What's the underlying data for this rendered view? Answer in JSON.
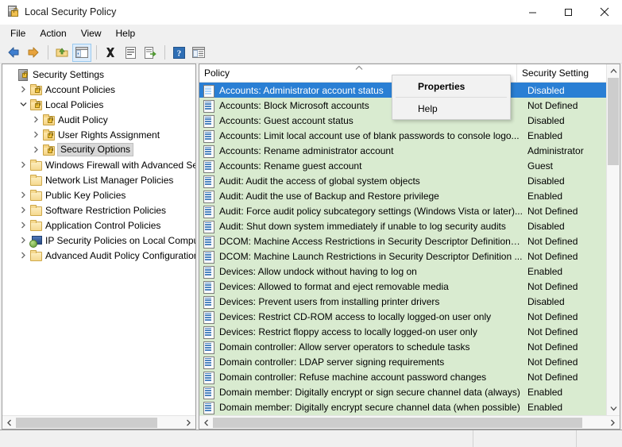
{
  "window": {
    "title": "Local Security Policy",
    "icon": "security-policy-icon",
    "controls": {
      "minimize": "—",
      "maximize": "☐",
      "close": "✕"
    }
  },
  "menubar": {
    "items": [
      "File",
      "Action",
      "View",
      "Help"
    ]
  },
  "toolbar": {
    "buttons": [
      {
        "name": "back-icon",
        "glyph": "back"
      },
      {
        "name": "forward-icon",
        "glyph": "forward"
      },
      {
        "name": "up-folder-icon",
        "glyph": "upfolder"
      },
      {
        "name": "show-tree-icon",
        "glyph": "showtree",
        "active": true
      },
      {
        "name": "delete-icon",
        "glyph": "delete"
      },
      {
        "name": "properties-icon",
        "glyph": "properties"
      },
      {
        "name": "export-list-icon",
        "glyph": "export"
      },
      {
        "name": "help-icon",
        "glyph": "help"
      },
      {
        "name": "list-view-icon",
        "glyph": "listview"
      }
    ]
  },
  "tree": {
    "items": [
      {
        "label": "Security Settings",
        "indent": 0,
        "expander": "none",
        "icon": "root",
        "selected": false
      },
      {
        "label": "Account Policies",
        "indent": 1,
        "expander": "collapsed",
        "icon": "lockfolder",
        "selected": false
      },
      {
        "label": "Local Policies",
        "indent": 1,
        "expander": "expanded",
        "icon": "lockfolder",
        "selected": false
      },
      {
        "label": "Audit Policy",
        "indent": 2,
        "expander": "collapsed",
        "icon": "lockfolder",
        "selected": false
      },
      {
        "label": "User Rights Assignment",
        "indent": 2,
        "expander": "collapsed",
        "icon": "lockfolder",
        "selected": false
      },
      {
        "label": "Security Options",
        "indent": 2,
        "expander": "collapsed",
        "icon": "lockfolder",
        "selected": true
      },
      {
        "label": "Windows Firewall with Advanced Sec",
        "indent": 1,
        "expander": "collapsed",
        "icon": "plainfolder",
        "selected": false
      },
      {
        "label": "Network List Manager Policies",
        "indent": 1,
        "expander": "none",
        "icon": "plainfolder",
        "selected": false
      },
      {
        "label": "Public Key Policies",
        "indent": 1,
        "expander": "collapsed",
        "icon": "plainfolder",
        "selected": false
      },
      {
        "label": "Software Restriction Policies",
        "indent": 1,
        "expander": "collapsed",
        "icon": "plainfolder",
        "selected": false
      },
      {
        "label": "Application Control Policies",
        "indent": 1,
        "expander": "collapsed",
        "icon": "plainfolder",
        "selected": false
      },
      {
        "label": "IP Security Policies on Local Compute",
        "indent": 1,
        "expander": "collapsed",
        "icon": "ipsec",
        "selected": false
      },
      {
        "label": "Advanced Audit Policy Configuration",
        "indent": 1,
        "expander": "collapsed",
        "icon": "plainfolder",
        "selected": false
      }
    ]
  },
  "list": {
    "columns": [
      {
        "label": "Policy",
        "sort": "ascending"
      },
      {
        "label": "Security Setting",
        "sort": "none"
      }
    ],
    "rows": [
      {
        "policy": "Accounts: Administrator account status",
        "setting": "Disabled",
        "selected": true
      },
      {
        "policy": "Accounts: Block Microsoft accounts",
        "setting": "Not Defined",
        "selected": false
      },
      {
        "policy": "Accounts: Guest account status",
        "setting": "Disabled",
        "selected": false
      },
      {
        "policy": "Accounts: Limit local account use of blank passwords to console logo...",
        "setting": "Enabled",
        "selected": false
      },
      {
        "policy": "Accounts: Rename administrator account",
        "setting": "Administrator",
        "selected": false
      },
      {
        "policy": "Accounts: Rename guest account",
        "setting": "Guest",
        "selected": false
      },
      {
        "policy": "Audit: Audit the access of global system objects",
        "setting": "Disabled",
        "selected": false
      },
      {
        "policy": "Audit: Audit the use of Backup and Restore privilege",
        "setting": "Enabled",
        "selected": false
      },
      {
        "policy": "Audit: Force audit policy subcategory settings (Windows Vista or later)...",
        "setting": "Not Defined",
        "selected": false
      },
      {
        "policy": "Audit: Shut down system immediately if unable to log security audits",
        "setting": "Disabled",
        "selected": false
      },
      {
        "policy": "DCOM: Machine Access Restrictions in Security Descriptor Definition L...",
        "setting": "Not Defined",
        "selected": false
      },
      {
        "policy": "DCOM: Machine Launch Restrictions in Security Descriptor Definition ...",
        "setting": "Not Defined",
        "selected": false
      },
      {
        "policy": "Devices: Allow undock without having to log on",
        "setting": "Enabled",
        "selected": false
      },
      {
        "policy": "Devices: Allowed to format and eject removable media",
        "setting": "Not Defined",
        "selected": false
      },
      {
        "policy": "Devices: Prevent users from installing printer drivers",
        "setting": "Disabled",
        "selected": false
      },
      {
        "policy": "Devices: Restrict CD-ROM access to locally logged-on user only",
        "setting": "Not Defined",
        "selected": false
      },
      {
        "policy": "Devices: Restrict floppy access to locally logged-on user only",
        "setting": "Not Defined",
        "selected": false
      },
      {
        "policy": "Domain controller: Allow server operators to schedule tasks",
        "setting": "Not Defined",
        "selected": false
      },
      {
        "policy": "Domain controller: LDAP server signing requirements",
        "setting": "Not Defined",
        "selected": false
      },
      {
        "policy": "Domain controller: Refuse machine account password changes",
        "setting": "Not Defined",
        "selected": false
      },
      {
        "policy": "Domain member: Digitally encrypt or sign secure channel data (always)",
        "setting": "Enabled",
        "selected": false
      },
      {
        "policy": "Domain member: Digitally encrypt secure channel data (when possible)",
        "setting": "Enabled",
        "selected": false
      }
    ]
  },
  "context_menu": {
    "items": [
      {
        "label": "Properties",
        "bold": true
      },
      {
        "label": "Help",
        "bold": false
      }
    ]
  },
  "statusbar": {
    "text": ""
  },
  "colors": {
    "selection_blue": "#2a7fd4",
    "list_background_green": "#d9ebd0",
    "tree_selection_gray": "#d8d8d8",
    "window_chrome": "#f0f0f0"
  }
}
